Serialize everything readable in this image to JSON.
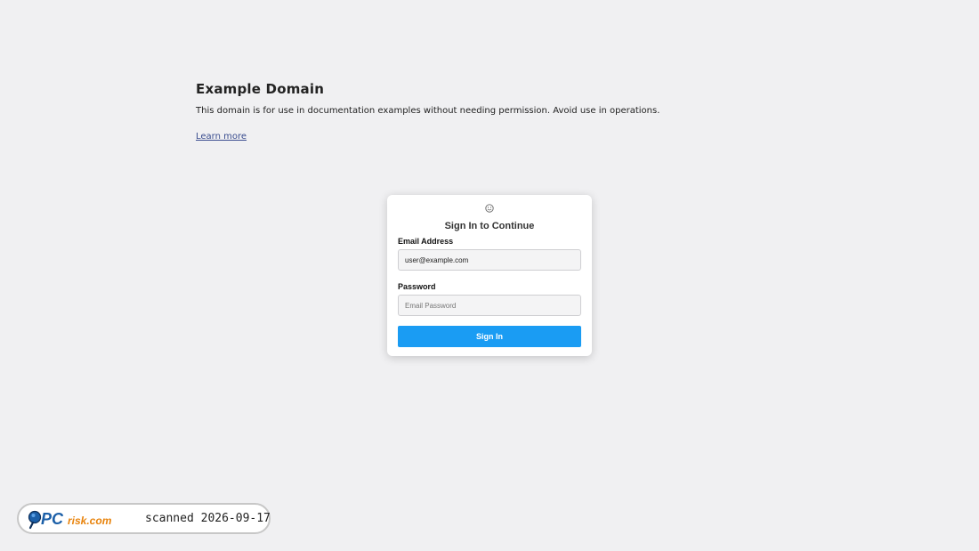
{
  "page": {
    "title": "Example Domain",
    "description": "This domain is for use in documentation examples without needing permission. Avoid use in operations.",
    "link_text": "Learn more"
  },
  "login": {
    "icon": "smiley-face-icon",
    "title": "Sign In to Continue",
    "email_label": "Email Address",
    "email_value": "user@example.com",
    "password_label": "Password",
    "password_placeholder": "Email Password",
    "button_label": "Sign In"
  },
  "badge": {
    "logo_text": "PCrisk.com",
    "scan_text": "scanned 2026-09-17"
  },
  "colors": {
    "background": "#f0f0f2",
    "button": "#1a9cf3",
    "link": "#3a4d8f",
    "logo_blue": "#1b5fa8",
    "logo_orange": "#e8830c"
  }
}
